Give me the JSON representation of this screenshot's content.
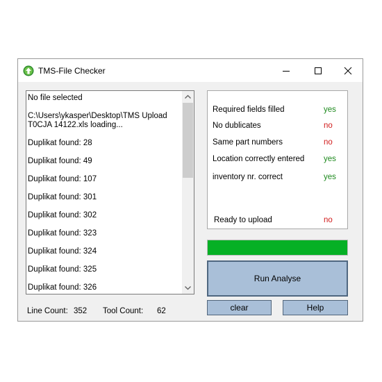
{
  "window": {
    "title": "TMS-File Checker"
  },
  "log": {
    "lines": [
      "No file selected",
      "C:\\Users\\ykasper\\Desktop\\TMS Upload",
      "T0CJA 14122.xls loading...",
      "Duplikat found: 28",
      "Duplikat found: 49",
      "Duplikat found: 107",
      "Duplikat found: 301",
      "Duplikat found: 302",
      "Duplikat found: 323",
      "Duplikat found: 324",
      "Duplikat found: 325",
      "Duplikat found: 326"
    ]
  },
  "footer": {
    "line_count_label": "Line Count:",
    "line_count_value": "352",
    "tool_count_label": "Tool Count:",
    "tool_count_value": "62"
  },
  "status": {
    "rows": [
      {
        "label": "Required fields filled",
        "value": "yes"
      },
      {
        "label": "No dublicates",
        "value": "no"
      },
      {
        "label": "Same part numbers",
        "value": "no"
      },
      {
        "label": "Location correctly entered",
        "value": "yes"
      },
      {
        "label": "inventory nr. correct",
        "value": "yes"
      }
    ],
    "ready_label": "Ready to upload",
    "ready_value": "no"
  },
  "progress": {
    "value": 1.0,
    "color": "#06b025"
  },
  "buttons": {
    "run": "Run Analyse",
    "clear": "clear",
    "help": "Help"
  },
  "icons": {
    "app": "green-circle-app-icon",
    "minimize": "minimize-icon",
    "maximize": "maximize-icon",
    "close": "close-icon"
  }
}
